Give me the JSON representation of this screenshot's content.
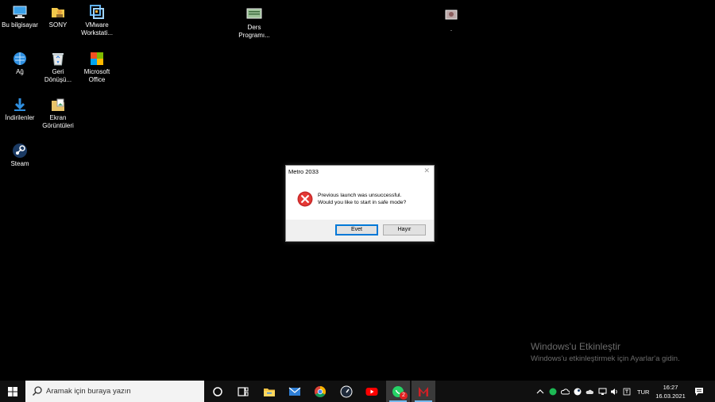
{
  "desktop": {
    "icons": [
      {
        "label": "Bu bilgisayar"
      },
      {
        "label": "SONY"
      },
      {
        "label": "VMware Workstati..."
      },
      {
        "label": "Ders Programı..."
      },
      {
        "label": "."
      },
      {
        "label": "Ağ"
      },
      {
        "label": "Geri Dönüşü..."
      },
      {
        "label": "Microsoft Office"
      },
      {
        "label": "İndirilenler"
      },
      {
        "label": "Ekran Görüntüleri"
      },
      {
        "label": "Steam"
      }
    ]
  },
  "dialog": {
    "title": "Metro 2033",
    "close_glyph": "✕",
    "message_line1": "Previous launch was unsuccessful.",
    "message_line2": "Would you like to start in safe mode?",
    "yes_label": "Evet",
    "no_label": "Hayır",
    "icon": "error-icon"
  },
  "watermark": {
    "line1": "Windows'u Etkinleştir",
    "line2": "Windows'u etkinleştirmek için Ayarlar'a gidin."
  },
  "taskbar": {
    "search_placeholder": "Aramak için buraya yazın",
    "apps": [
      "cortana-icon",
      "task-view-icon",
      "file-explorer-icon",
      "mail-icon",
      "chrome-icon",
      "speedtest-icon",
      "youtube-icon",
      "whatsapp-icon",
      "metro-icon"
    ],
    "whatsapp_badge": "2",
    "tray_language": "TUR",
    "clock_time": "16:27",
    "clock_date": "16.03.2021"
  },
  "colors": {
    "accent": "#0078d7",
    "error_red": "#d32f2f",
    "taskbar_bg": "#101010"
  }
}
